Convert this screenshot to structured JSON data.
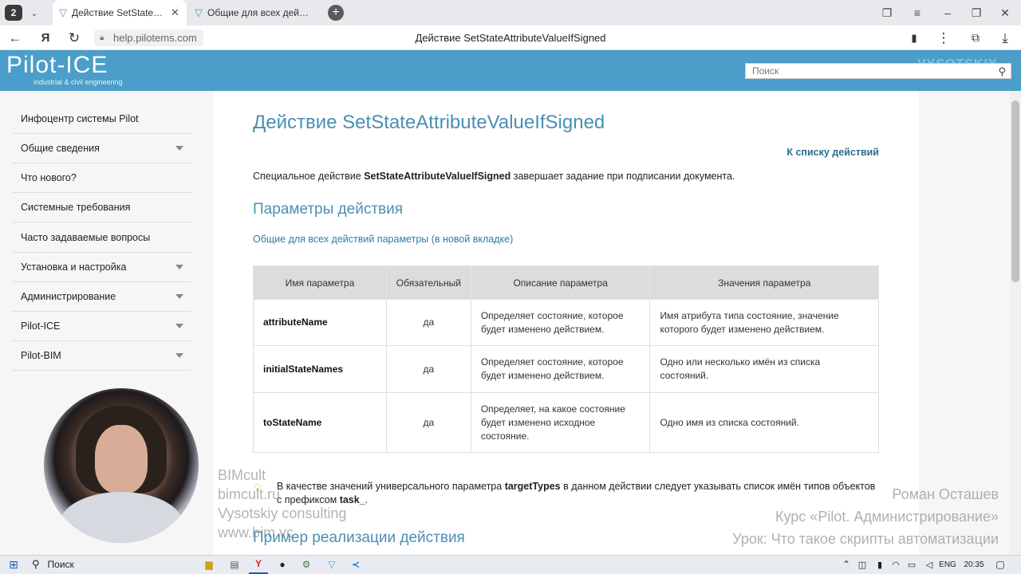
{
  "browser": {
    "tab_count": "2",
    "tabs": [
      {
        "title": "Действие SetStateAttrib",
        "active": true
      },
      {
        "title": "Общие для всех действий"
      }
    ],
    "domain": "help.pilotems.com",
    "page_title": "Действие SetStateAttributeValueIfSigned"
  },
  "site": {
    "logo_text": "Pilot-ICE",
    "logo_sub": "industrial & civil engineering",
    "search_placeholder": "Поиск",
    "header_watermark": "VYSOTSKIY"
  },
  "sidebar": {
    "items": [
      {
        "label": "Инфоцентр системы Pilot",
        "has_caret": false
      },
      {
        "label": "Общие сведения",
        "has_caret": true
      },
      {
        "label": "Что нового?",
        "has_caret": false
      },
      {
        "label": "Системные требования",
        "has_caret": false
      },
      {
        "label": "Часто задаваемые вопросы",
        "has_caret": false
      },
      {
        "label": "Установка и настройка",
        "has_caret": true
      },
      {
        "label": "Администрирование",
        "has_caret": true
      },
      {
        "label": "Pilot-ICE",
        "has_caret": true
      },
      {
        "label": "Pilot-BIM",
        "has_caret": true
      }
    ]
  },
  "content": {
    "title": "Действие SetStateAttributeValueIfSigned",
    "back_link": "К списку действий",
    "intro_prefix": "Специальное действие ",
    "intro_action": "SetStateAttributeValueIfSigned",
    "intro_suffix": " завершает задание при подписании документа.",
    "params_heading": "Параметры действия",
    "common_link": "Общие для всех действий параметры (в новой вкладке)",
    "table": {
      "headers": [
        "Имя параметра",
        "Обязательный",
        "Описание параметра",
        "Значения параметра"
      ],
      "rows": [
        {
          "name": "attributeName",
          "required": "да",
          "description": "Определяет состояние, которое будет изменено действием.",
          "values": "Имя атрибута типа состояние, значение которого будет изменено действием."
        },
        {
          "name": "initialStateNames",
          "required": "да",
          "description": "Определяет состояние, которое будет изменено действием.",
          "values": "Одно или несколько имён из списка состояний."
        },
        {
          "name": "toStateName",
          "required": "да",
          "description": "Определяет, на какое состояние будет изменено исходное состояние.",
          "values": "Одно имя из списка состояний."
        }
      ]
    },
    "note_prefix": "В качестве значений универсального параметра ",
    "note_param": "targetTypes",
    "note_middle": " в данном действии следует указывать список имён типов объектов с префиксом ",
    "note_prefix_value": "task_",
    "note_end": ".",
    "example_heading": "Пример реализации действия"
  },
  "overlay": {
    "left_lines": [
      "BIMcult",
      "bimcult.ru",
      "Vysotskiy consulting",
      "www.bim.vc"
    ],
    "credits": [
      "Роман Осташев",
      "Курс «Pilot. Администрирование»",
      "Урок: Что такое скрипты автоматизации"
    ]
  },
  "taskbar": {
    "search_label": "Поиск",
    "lang": "ENG",
    "time": "20:35"
  }
}
